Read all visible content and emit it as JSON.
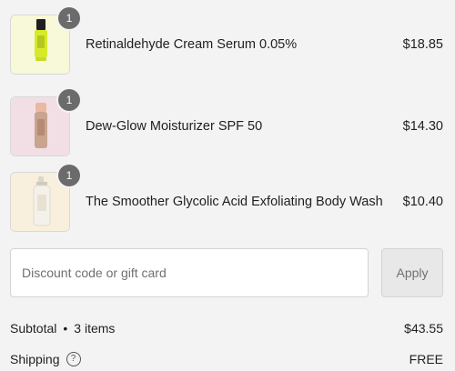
{
  "cart": {
    "items": [
      {
        "quantity": "1",
        "name": "Retinaldehyde Cream Serum 0.05%",
        "price": "$18.85",
        "thumbnail_color": "#f7f9d8",
        "product_color": "#d7ea2a",
        "cap_color": "#1f1f1f",
        "icon": "serum-tube-icon"
      },
      {
        "quantity": "1",
        "name": "Dew-Glow Moisturizer SPF 50",
        "price": "$14.30",
        "thumbnail_color": "#f2dfe6",
        "product_color": "#c9a48f",
        "cap_color": "#e9b9a3",
        "icon": "moisturizer-tube-icon"
      },
      {
        "quantity": "1",
        "name": "The Smoother Glycolic Acid Exfoliating Body Wash",
        "price": "$10.40",
        "thumbnail_color": "#f8efdc",
        "product_color": "#f4f1ea",
        "cap_color": "#dcd7cc",
        "icon": "body-wash-bottle-icon"
      }
    ]
  },
  "discount": {
    "placeholder": "Discount code or gift card",
    "value": "",
    "apply_label": "Apply"
  },
  "summary": {
    "subtotal_label": "Subtotal",
    "separator": "•",
    "item_count": "3 items",
    "subtotal_value": "$43.55",
    "shipping_label": "Shipping",
    "shipping_help_icon": "question-circle-icon",
    "shipping_help_glyph": "?",
    "shipping_value": "FREE"
  }
}
